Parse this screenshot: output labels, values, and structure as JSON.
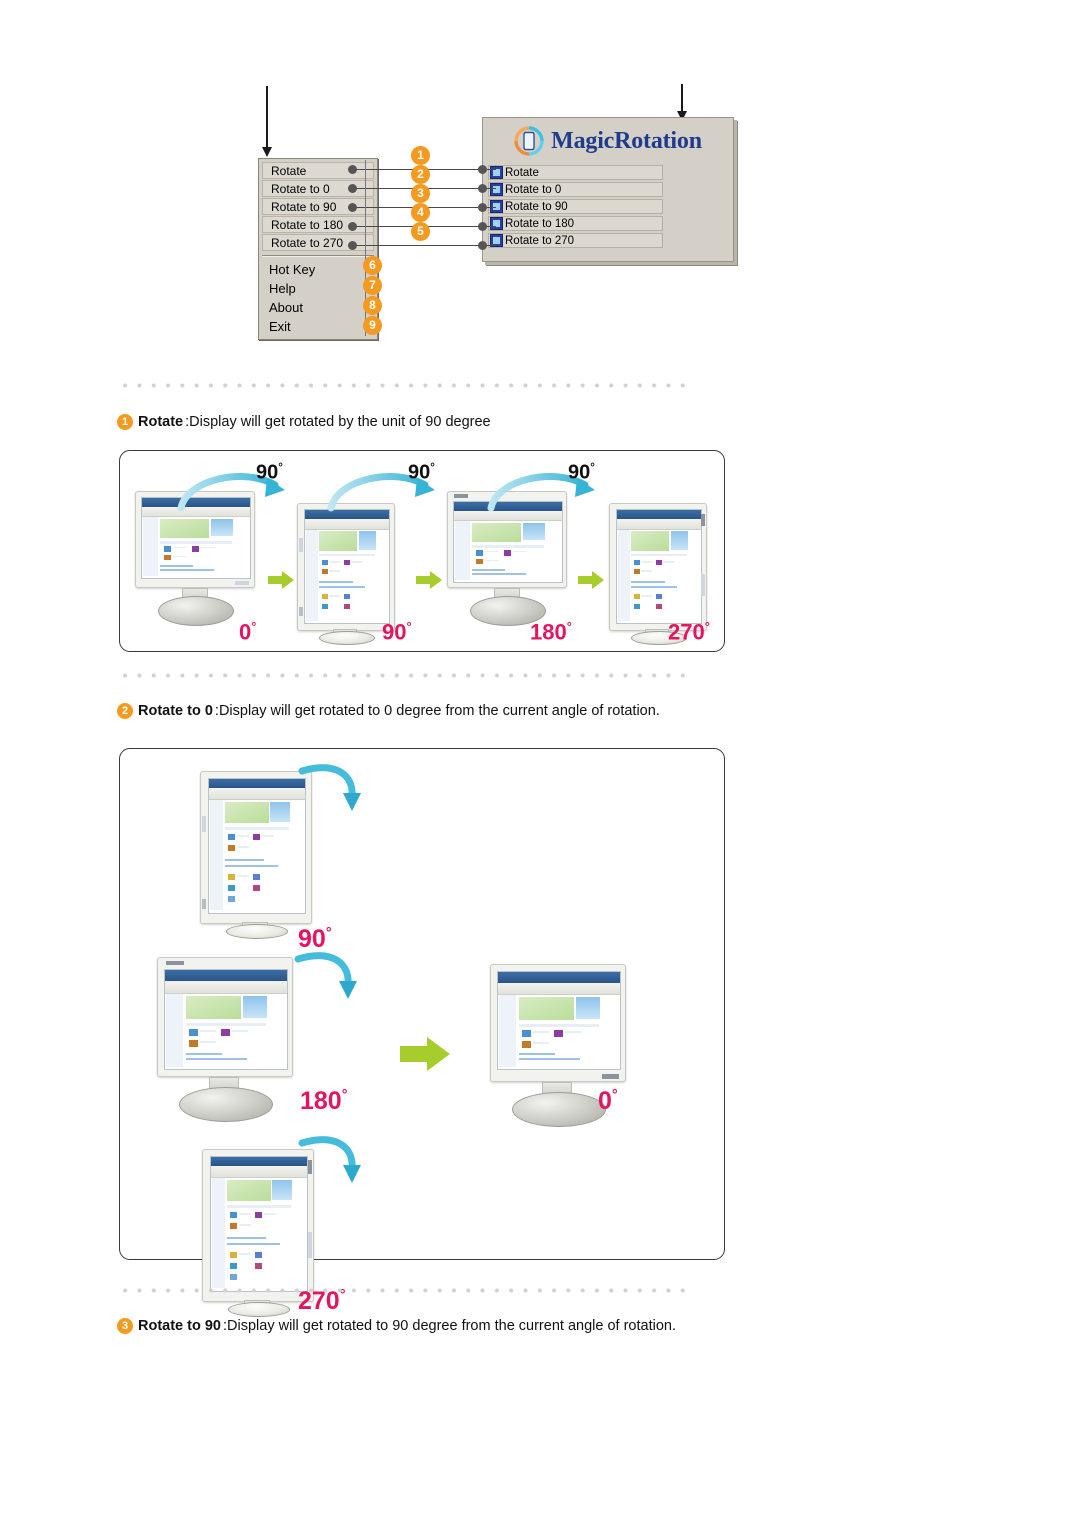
{
  "top_diagram": {
    "left_menu": {
      "name": "magicrotation-tray-menu",
      "items": [
        "Rotate",
        "Rotate to 0",
        "Rotate to 90",
        "Rotate to 180",
        "Rotate to 270"
      ],
      "plain_items": [
        "Hot Key",
        "Help",
        "About",
        "Exit"
      ]
    },
    "right_panel": {
      "brand": "MagicRotation",
      "logo_icon": "magicrotation-logo-icon",
      "items": [
        "Rotate",
        "Rotate to 0",
        "Rotate to 90",
        "Rotate to 180",
        "Rotate to 270"
      ]
    },
    "callout_numbers": [
      "1",
      "2",
      "3",
      "4",
      "5",
      "6",
      "7",
      "8",
      "9"
    ]
  },
  "sections": [
    {
      "badge": "1",
      "term": "Rotate",
      "separator": " : ",
      "text": "Display will get rotated by the unit of 90 degree"
    },
    {
      "badge": "2",
      "term": "Rotate to 0",
      "separator": " : ",
      "text": "Display will get rotated to 0 degree from the current angle of rotation."
    },
    {
      "badge": "3",
      "term": "Rotate to 90",
      "separator": " : ",
      "text": "Display will get rotated to 90 degree from the current angle of rotation."
    }
  ],
  "figure1": {
    "name": "rotate-sequence-figure",
    "step_arrow_labels": [
      "90",
      "90",
      "90"
    ],
    "state_labels": [
      "0",
      "90",
      "180",
      "270"
    ],
    "degree_symbol": "°"
  },
  "figure2": {
    "name": "rotate-to-0-figure",
    "source_labels": [
      "90",
      "180",
      "270"
    ],
    "target_label": "0",
    "degree_symbol": "°"
  },
  "colors": {
    "accent_orange": "#f59a20",
    "degree_pink": "#e5145f",
    "brand_blue": "#1f3b8c",
    "arrow_cyan": "#3fb8d8",
    "arrow_green": "#a6cd2c",
    "menu_gray": "#d4d0c8",
    "dot_gray": "#d2d2d2"
  }
}
